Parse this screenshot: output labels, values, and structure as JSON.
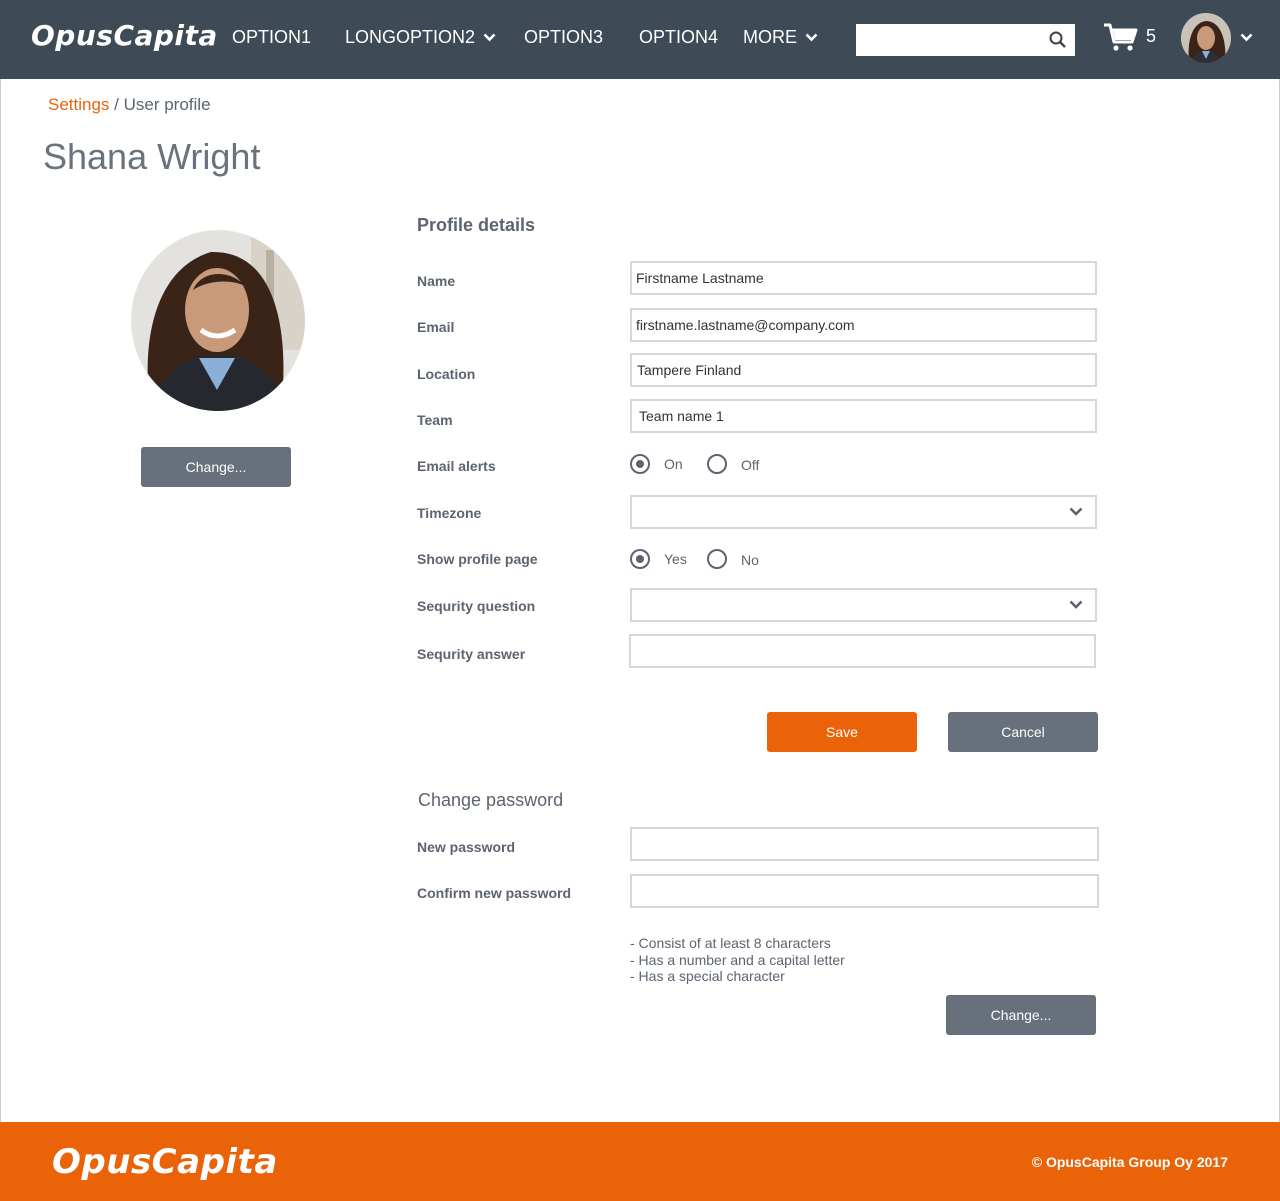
{
  "header": {
    "logo": "OpusCapita",
    "nav": [
      {
        "label": "OPTION1"
      },
      {
        "label": "LONGOPTION2"
      },
      {
        "label": "OPTION3"
      },
      {
        "label": "OPTION4"
      },
      {
        "label": "MORE"
      }
    ],
    "search": {
      "placeholder": "",
      "value": ""
    },
    "cart_count": "5"
  },
  "breadcrumb": {
    "parent": "Settings",
    "separator": " / ",
    "current": "User profile"
  },
  "page_title": "Shana Wright",
  "photo": {
    "change_button": "Change..."
  },
  "profile": {
    "title": "Profile details",
    "fields": {
      "name": {
        "label": "Name",
        "value": "Firstname Lastname"
      },
      "email": {
        "label": "Email",
        "value": "firstname.lastname@company.com"
      },
      "location": {
        "label": "Location",
        "value": "Tampere Finland"
      },
      "team": {
        "label": "Team",
        "value": "Team name 1"
      },
      "email_alerts": {
        "label": "Email alerts",
        "on": "On",
        "off": "Off",
        "selected": "On"
      },
      "timezone": {
        "label": "Timezone",
        "value": ""
      },
      "show_profile": {
        "label": "Show profile page",
        "yes": "Yes",
        "no": "No",
        "selected": "Yes"
      },
      "security_question": {
        "label": "Sequrity question",
        "value": ""
      },
      "security_answer": {
        "label": "Sequrity answer",
        "value": ""
      }
    },
    "save": "Save",
    "cancel": "Cancel"
  },
  "password": {
    "title": "Change password",
    "new_label": "New password",
    "confirm_label": "Confirm new password",
    "rules": [
      "- Consist of at least 8 characters",
      "- Has a number and a capital letter",
      "- Has a special character"
    ],
    "change_button": "Change..."
  },
  "footer": {
    "logo": "OpusCapita",
    "copyright": "© OpusCapita Group Oy 2017"
  },
  "colors": {
    "header_bg": "#3e4a56",
    "accent": "#ea6309",
    "button_gray": "#68707b"
  }
}
